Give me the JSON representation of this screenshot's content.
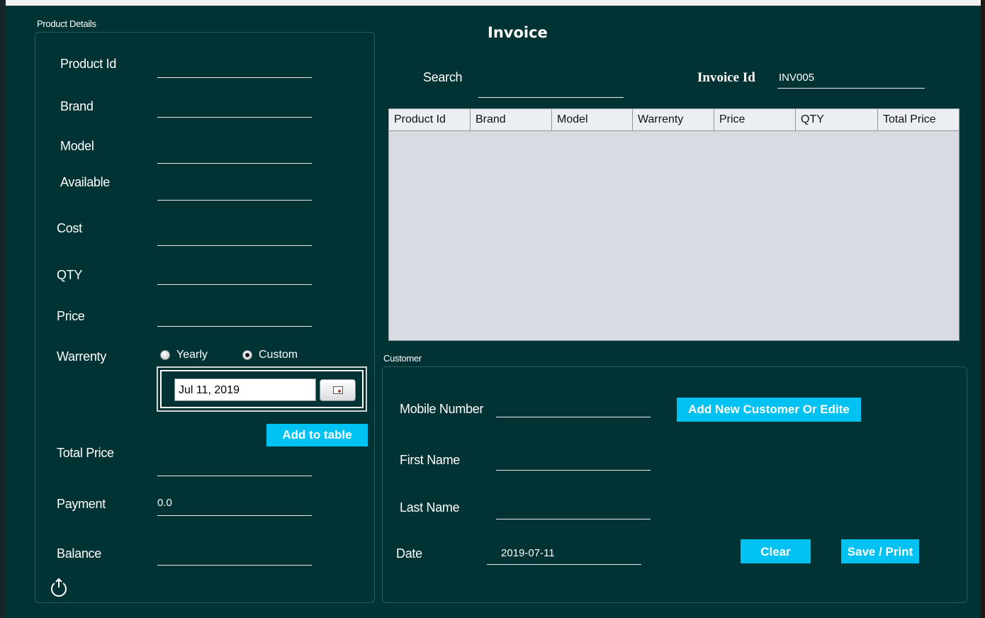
{
  "product_details": {
    "group_title": "Product Details",
    "labels": {
      "product_id": "Product Id",
      "brand": "Brand",
      "model": "Model",
      "available": "Available",
      "cost": "Cost",
      "qty": "QTY",
      "price": "Price",
      "warrenty": "Warrenty",
      "total_price": "Total Price",
      "payment": "Payment",
      "balance": "Balance"
    },
    "values": {
      "payment": "0.0"
    },
    "warrenty_options": {
      "yearly": "Yearly",
      "custom": "Custom",
      "selected": "custom"
    },
    "date_value": "Jul 11, 2019",
    "add_to_table_label": "Add to table",
    "power_icon": "power-icon"
  },
  "invoice": {
    "title": "Invoice",
    "search_label": "Search",
    "invoice_id_label": "Invoice Id",
    "invoice_id_value": "INV005",
    "table": {
      "columns": [
        "Product Id",
        "Brand",
        "Model",
        "Warrenty",
        "Price",
        "QTY",
        "Total Price"
      ],
      "rows": []
    }
  },
  "customer": {
    "group_title": "Customer",
    "labels": {
      "mobile_number": "Mobile Number",
      "first_name": "First Name",
      "last_name": "Last Name",
      "date": "Date"
    },
    "values": {
      "date": "2019-07-11"
    },
    "add_customer_label": "Add New Customer Or Edite",
    "clear_label": "Clear",
    "save_print_label": "Save / Print"
  },
  "colors": {
    "window_bg": "#013334",
    "accent_button": "#00c2f2",
    "table_bg": "#d8dbe1"
  }
}
